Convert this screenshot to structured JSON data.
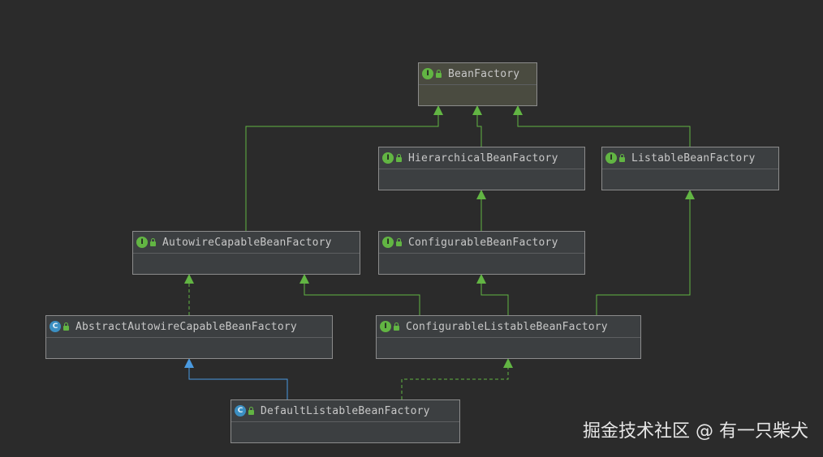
{
  "colors": {
    "background": "#2b2b2b",
    "interface_badge": "#62b543",
    "class_badge": "#3b8fc2",
    "extends_interface_edge": "#62b543",
    "extends_class_edge": "#4a9ae0"
  },
  "nodes": {
    "bean_factory": {
      "label": "BeanFactory",
      "kind": "interface",
      "badge": "I",
      "icon": "interface-icon"
    },
    "hierarchical_bean_factory": {
      "label": "HierarchicalBeanFactory",
      "kind": "interface",
      "badge": "I",
      "icon": "interface-icon"
    },
    "listable_bean_factory": {
      "label": "ListableBeanFactory",
      "kind": "interface",
      "badge": "I",
      "icon": "interface-icon"
    },
    "autowire_capable_bean_factory": {
      "label": "AutowireCapableBeanFactory",
      "kind": "interface",
      "badge": "I",
      "icon": "interface-icon"
    },
    "configurable_bean_factory": {
      "label": "ConfigurableBeanFactory",
      "kind": "interface",
      "badge": "I",
      "icon": "interface-icon"
    },
    "abstract_autowire_capable_bean_factory": {
      "label": "AbstractAutowireCapableBeanFactory",
      "kind": "class",
      "badge": "C",
      "icon": "class-icon"
    },
    "configurable_listable_bean_factory": {
      "label": "ConfigurableListableBeanFactory",
      "kind": "interface",
      "badge": "I",
      "icon": "interface-icon"
    },
    "default_listable_bean_factory": {
      "label": "DefaultListableBeanFactory",
      "kind": "class",
      "badge": "C",
      "icon": "class-icon"
    }
  },
  "edges": [
    {
      "from": "hierarchical_bean_factory",
      "to": "bean_factory",
      "style": "solid"
    },
    {
      "from": "listable_bean_factory",
      "to": "bean_factory",
      "style": "solid"
    },
    {
      "from": "autowire_capable_bean_factory",
      "to": "bean_factory",
      "style": "solid"
    },
    {
      "from": "configurable_bean_factory",
      "to": "hierarchical_bean_factory",
      "style": "solid"
    },
    {
      "from": "abstract_autowire_capable_bean_factory",
      "to": "autowire_capable_bean_factory",
      "style": "dashed"
    },
    {
      "from": "configurable_listable_bean_factory",
      "to": "autowire_capable_bean_factory",
      "style": "solid"
    },
    {
      "from": "configurable_listable_bean_factory",
      "to": "configurable_bean_factory",
      "style": "solid"
    },
    {
      "from": "configurable_listable_bean_factory",
      "to": "listable_bean_factory",
      "style": "solid"
    },
    {
      "from": "default_listable_bean_factory",
      "to": "abstract_autowire_capable_bean_factory",
      "style": "solid-class"
    },
    {
      "from": "default_listable_bean_factory",
      "to": "configurable_listable_bean_factory",
      "style": "dashed"
    }
  ],
  "watermark": "掘金技术社区 @ 有一只柴犬"
}
